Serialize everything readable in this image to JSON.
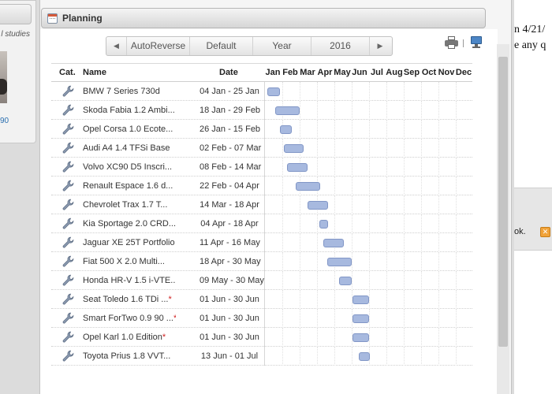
{
  "left_panel": {
    "studies_text": "l studies",
    "link_text": "90"
  },
  "right_doc": {
    "line1": "n 4/21/",
    "line2": "e any q",
    "ok_text": "ok."
  },
  "panel": {
    "title": "Planning"
  },
  "toolbar": {
    "prev_label": "◀",
    "auto_reverse_label": "AutoReverse",
    "default_label": "Default",
    "year_label": "Year",
    "year_value": "2016",
    "next_label": "▶"
  },
  "grid": {
    "headers": {
      "category": "Cat.",
      "name": "Name",
      "date": "Date"
    },
    "months": [
      "Jan",
      "Feb",
      "Mar",
      "Apr",
      "May",
      "Jun",
      "Jul",
      "Aug",
      "Sep",
      "Oct",
      "Nov",
      "Dec"
    ],
    "rows": [
      {
        "name": "BMW 7 Series 730d",
        "star": "",
        "date": "04 Jan - 25 Jan",
        "start": 4,
        "end": 25
      },
      {
        "name": "Skoda Fabia 1.2 Ambi...",
        "star": "",
        "date": "18 Jan - 29 Feb",
        "start": 18,
        "end": 60
      },
      {
        "name": "Opel Corsa 1.0 Ecote...",
        "star": "",
        "date": "26 Jan - 15 Feb",
        "start": 26,
        "end": 46
      },
      {
        "name": "Audi A4 1.4 TFSi Base",
        "star": "",
        "date": "02 Feb - 07 Mar",
        "start": 33,
        "end": 67
      },
      {
        "name": "Volvo XC90 D5 Inscri...",
        "star": "",
        "date": "08 Feb - 14 Mar",
        "start": 39,
        "end": 74
      },
      {
        "name": "Renault Espace 1.6 d...",
        "star": "",
        "date": "22 Feb - 04 Apr",
        "start": 53,
        "end": 95
      },
      {
        "name": "Chevrolet Trax 1.7 T...",
        "star": "",
        "date": "14 Mar - 18 Apr",
        "start": 74,
        "end": 109
      },
      {
        "name": "Kia Sportage 2.0 CRD...",
        "star": "",
        "date": "04 Apr - 18 Apr",
        "start": 95,
        "end": 109
      },
      {
        "name": "Jaguar XE 25T Portfolio",
        "star": "",
        "date": "11 Apr - 16 May",
        "start": 102,
        "end": 137
      },
      {
        "name": "Fiat 500 X 2.0 Multi...",
        "star": "",
        "date": "18 Apr - 30 May",
        "start": 109,
        "end": 151
      },
      {
        "name": "Honda HR-V 1.5 i-VTE...",
        "star": "",
        "date": "09 May - 30 May",
        "start": 130,
        "end": 151
      },
      {
        "name": "Seat Toledo 1.6 TDi ...",
        "star": "*",
        "date": "01 Jun - 30 Jun",
        "start": 153,
        "end": 182
      },
      {
        "name": "Smart ForTwo 0.9 90 ...",
        "star": "*",
        "date": "01 Jun - 30 Jun",
        "start": 153,
        "end": 182
      },
      {
        "name": "Opel Karl 1.0 Edition",
        "star": "*",
        "date": "01 Jun - 30 Jun",
        "start": 153,
        "end": 182
      },
      {
        "name": "Toyota Prius 1.8 VVT...",
        "star": "",
        "date": "13 Jun - 01 Jul",
        "start": 165,
        "end": 183
      }
    ]
  },
  "colors": {
    "bar_fill": "#a7b9df",
    "bar_border": "#8196c6",
    "required_star": "#d02020"
  },
  "icons": {
    "category": "wrench-icon",
    "print": "print-icon",
    "monitor": "monitor-icon",
    "calendar": "calendar-icon"
  }
}
